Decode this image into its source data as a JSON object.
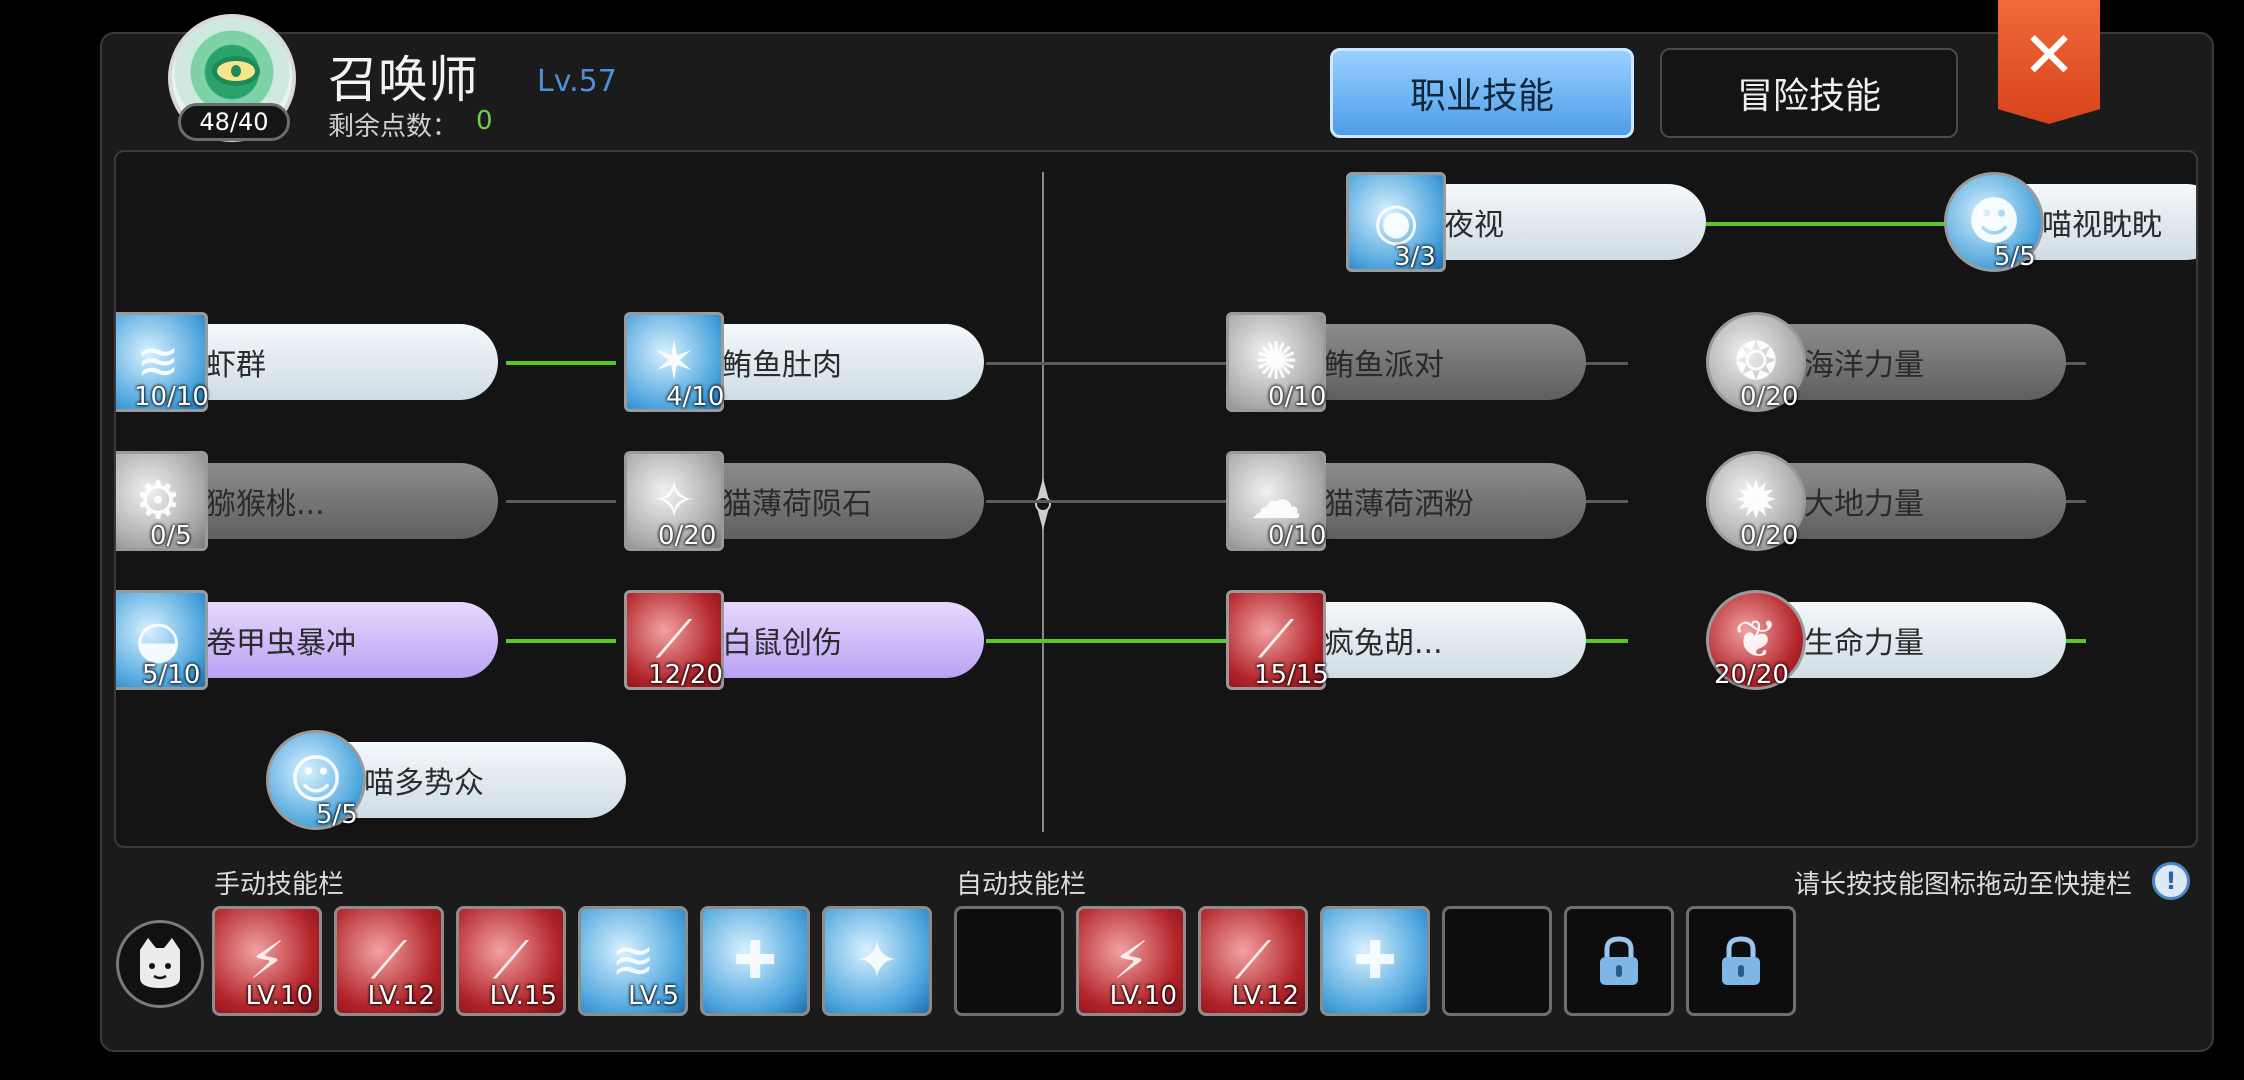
{
  "header": {
    "class_name": "召唤师",
    "class_level": "Lv.57",
    "emblem_level": "48/40",
    "points_label": "剩余点数：",
    "points_value": "0",
    "tab_active": "职业技能",
    "tab_inactive": "冒险技能",
    "close_label": "✕"
  },
  "skills": {
    "night_vision": {
      "name": "夜视",
      "count": "3/3"
    },
    "meow_vision": {
      "name": "喵视眈眈",
      "count": "5/5"
    },
    "shrimp": {
      "name": "虾群",
      "count": "10/10"
    },
    "tuna_belly": {
      "name": "鲔鱼肚肉",
      "count": "4/10"
    },
    "tuna_party": {
      "name": "鲔鱼派对",
      "count": "0/10"
    },
    "ocean_power": {
      "name": "海洋力量",
      "count": "0/20"
    },
    "monkey": {
      "name": "猕猴桃...",
      "count": "0/5"
    },
    "catnip_meteor": {
      "name": "猫薄荷陨石",
      "count": "0/20"
    },
    "catnip_powder": {
      "name": "猫薄荷洒粉",
      "count": "0/10"
    },
    "earth_power": {
      "name": "大地力量",
      "count": "0/20"
    },
    "beetle_rush": {
      "name": "卷甲虫暴冲",
      "count": "5/10"
    },
    "white_rat": {
      "name": "白鼠创伤",
      "count": "12/20"
    },
    "crazy_rabbit": {
      "name": "疯兔胡...",
      "count": "15/15"
    },
    "life_power": {
      "name": "生命力量",
      "count": "20/20"
    },
    "meow_crowd": {
      "name": "喵多势众",
      "count": "5/5"
    }
  },
  "quickbar": {
    "manual_label": "手动技能栏",
    "auto_label": "自动技能栏",
    "hint": "请长按技能图标拖动至快捷栏",
    "hint_icon": "!",
    "manual_slots": [
      "LV.10",
      "LV.12",
      "LV.15",
      "LV.5",
      "",
      ""
    ],
    "auto_slots": [
      "",
      "LV.10",
      "LV.12",
      "",
      "",
      "",
      ""
    ]
  },
  "colors": {
    "accent_blue": "#4d9de8",
    "connector_green": "#5ac728",
    "close_red": "#d8431b"
  }
}
